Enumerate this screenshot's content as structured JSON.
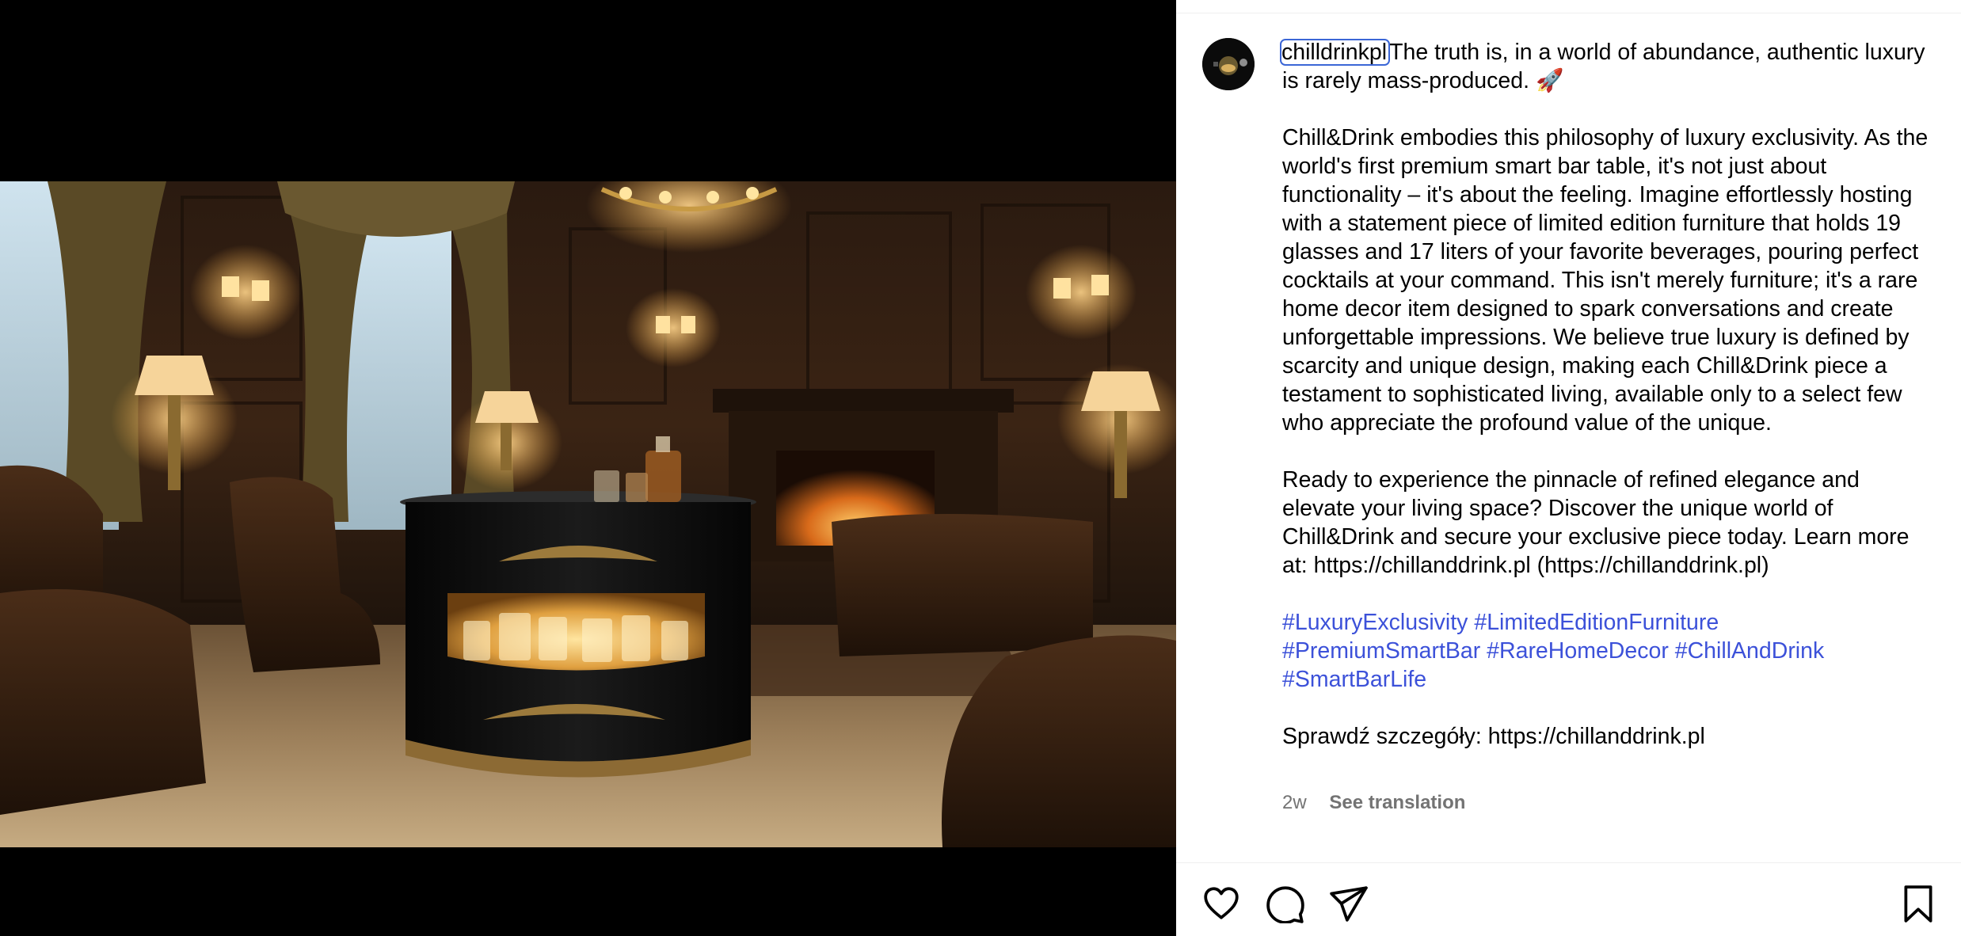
{
  "post": {
    "image_alt": "Luxury lounge with a black round smart bar table holding lit glasses",
    "author": {
      "username": "chilldrinkpl",
      "avatar_icon": "profile-avatar"
    },
    "caption": {
      "intro": "The truth is, in a world of abundance, authentic luxury is rarely mass-produced. 🚀",
      "paragraph_1": "Chill&Drink embodies this philosophy of luxury exclusivity. As the world's first premium smart bar table, it's not just about functionality – it's about the feeling. Imagine effortlessly hosting with a statement piece of limited edition furniture that holds 19 glasses and 17 liters of your favorite beverages, pouring perfect cocktails at your command. This isn't merely furniture; it's a rare home decor item designed to spark conversations and create unforgettable impressions. We believe true luxury is defined by scarcity and unique design, making each Chill&Drink piece a testament to sophisticated living, available only to a select few who appreciate the profound value of the unique.",
      "paragraph_2": "Ready to experience the pinnacle of refined elegance and elevate your living space? Discover the unique world of Chill&Drink and secure your exclusive piece today. Learn more at: https://chillanddrink.pl (https://chillanddrink.pl)",
      "hashtags": [
        "#LuxuryExclusivity",
        "#LimitedEditionFurniture",
        "#PremiumSmartBar",
        "#RareHomeDecor",
        "#ChillAndDrink",
        "#SmartBarLife"
      ],
      "paragraph_3": "Sprawdź szczegóły: https://chillanddrink.pl"
    },
    "timestamp": "2w",
    "see_translation": "See translation"
  },
  "actions": {
    "like_icon": "heart-icon",
    "comment_icon": "comment-icon",
    "share_icon": "share-icon",
    "save_icon": "bookmark-icon"
  },
  "colors": {
    "hashtag": "#3c51d9",
    "meta_text": "#737373",
    "focus_ring": "#3b66d6",
    "media_background": "#000000"
  }
}
